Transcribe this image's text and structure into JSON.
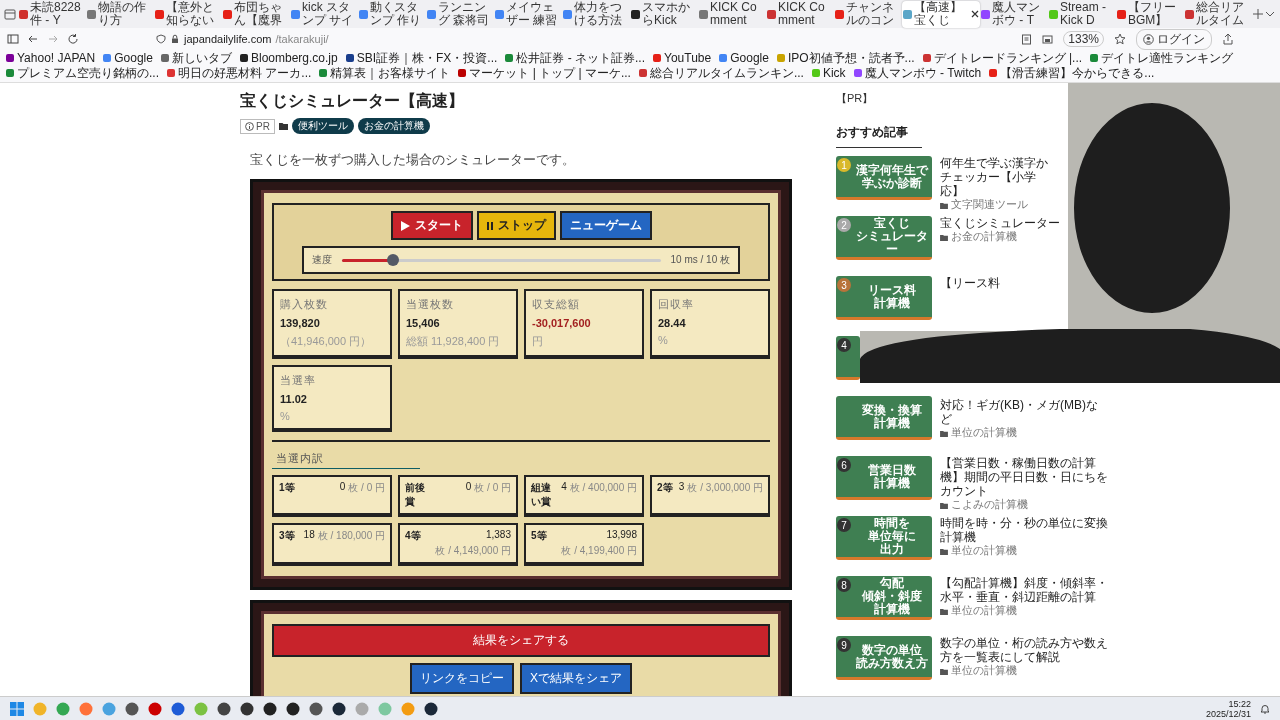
{
  "browser": {
    "tabs": [
      {
        "title": "未読8228件 - Y",
        "selected": false
      },
      {
        "title": "物語の作り方",
        "selected": false
      },
      {
        "title": "【意外と知らない",
        "selected": false
      },
      {
        "title": "布団ちゃん【魔界",
        "selected": false
      },
      {
        "title": "kick スタンプ サイ",
        "selected": false
      },
      {
        "title": "動くスタンプ 作り",
        "selected": false
      },
      {
        "title": "ランニング 森将司",
        "selected": false
      },
      {
        "title": "メイウェザー 練習",
        "selected": false
      },
      {
        "title": "体力をつける方法",
        "selected": false
      },
      {
        "title": "スマホからKick",
        "selected": false
      },
      {
        "title": "KICK Comment",
        "selected": false
      },
      {
        "title": "KICK Comment",
        "selected": false
      },
      {
        "title": "チャンネルのコン",
        "selected": false
      },
      {
        "title": "【高速】宝くじ",
        "selected": true
      },
      {
        "title": "魔人マンボウ - T",
        "selected": false
      },
      {
        "title": "Stream - Kick D",
        "selected": false
      },
      {
        "title": "【フリーBGM】",
        "selected": false
      },
      {
        "title": "総合リアルタイム",
        "selected": false
      }
    ],
    "address_host": "japandailylife.com",
    "address_path": "/takarakuji/",
    "zoom": "133%",
    "login": "ログイン",
    "bookmarks": [
      "Yahoo! JAPAN",
      "Google",
      "新しいタブ",
      "Bloomberg.co.jp",
      "SBI証券｜株・FX・投資...",
      "松井証券 - ネット証券...",
      "YouTube",
      "Google",
      "IPO初値予想・読者予...",
      "デイトレードランキング |...",
      "デイトレ適性ランキング",
      "プレミアム空売り銘柄の...",
      "明日の好悪材料 アーカ...",
      "精算表｜お客様サイト",
      "マーケット | トップ | マーケ...",
      "総合リアルタイムランキン...",
      "Kick",
      "魔人マンボウ - Twitch",
      "【滑舌練習】今からできる..."
    ]
  },
  "article": {
    "title": "宝くじシミュレーター【高速】",
    "pr": "PR",
    "tags": [
      "便利ツール",
      "お金の計算機"
    ],
    "description": "宝くじを一枚ずつ購入した場合のシミュレーターです。"
  },
  "simulator": {
    "buttons": [
      {
        "kind": "start",
        "label": "スタート"
      },
      {
        "kind": "stop",
        "label": "ストップ"
      },
      {
        "kind": "new",
        "label": "ニューゲーム"
      }
    ],
    "speed": {
      "label": "速度",
      "level": 0.16,
      "reading": "10 ms / 10 枚"
    },
    "stats": [
      {
        "label": "購入枚数",
        "value": "139,820",
        "sub": "（41,946,000 円）",
        "negative": false
      },
      {
        "label": "当選枚数",
        "value": "15,406",
        "sub": "総額 11,928,400 円",
        "negative": false
      },
      {
        "label": "収支総額",
        "value": "-30,017,600",
        "sub": "円",
        "negative": true
      },
      {
        "label": "回収率",
        "value": "28.44",
        "sub": "%",
        "negative": false
      },
      {
        "label": "当選率",
        "value": "11.02",
        "sub": "%",
        "negative": false
      }
    ],
    "breakdown_title": "当選内訳",
    "prizes": [
      {
        "name": "1等",
        "count": "0",
        "detail": "枚 / 0 円"
      },
      {
        "name": "前後賞",
        "count": "0",
        "detail": "枚 / 0 円"
      },
      {
        "name": "組違い賞",
        "count": "4",
        "detail": "枚 / 400,000 円"
      },
      {
        "name": "2等",
        "count": "3",
        "detail": "枚 / 3,000,000 円"
      },
      {
        "name": "3等",
        "count": "18",
        "detail": "枚 / 180,000 円"
      },
      {
        "name": "4等",
        "count": "1,383",
        "detail": "枚 / 4,149,000 円"
      },
      {
        "name": "5等",
        "count": "13,998",
        "detail": "枚 / 4,199,400 円"
      }
    ]
  },
  "share": {
    "title": "結果をシェアする",
    "buttons": [
      "リンクをコピー",
      "Xで結果をシェア"
    ]
  },
  "sidebar": {
    "pr": "【PR】",
    "heading": "おすすめ記事",
    "articles": [
      {
        "kind": "full",
        "rank": "1",
        "color": "#d9b92a",
        "thumb_lines": [
          "漢字何年生で",
          "学ぶか診断"
        ],
        "title_lines": [
          "何年生で学ぶ漢字か",
          "チェッカー【小学",
          "応】"
        ],
        "category": "文字関連ツール"
      },
      {
        "kind": "full",
        "rank": "2",
        "color": "#a9a9a9",
        "thumb_lines": [
          "宝くじ",
          "シミュレーター"
        ],
        "title_lines": [
          "宝くじシミュレーター"
        ],
        "category": "お金の計算機"
      },
      {
        "kind": "full",
        "rank": "3",
        "color": "#b8733a",
        "thumb_lines": [
          "リース料",
          "計算機"
        ],
        "title_lines": [
          "【リース料"
        ]
      },
      {
        "kind": "covered",
        "rank": "4",
        "color": "#333333"
      },
      {
        "kind": "cut",
        "thumb_lines": [
          "変換・換算",
          "計算機"
        ],
        "title_lines": [
          "対応！ギガ(KB)・メガ(MB)な",
          "ど"
        ],
        "category": "単位の計算機"
      },
      {
        "kind": "full",
        "rank": "6",
        "color": "#333333",
        "thumb_lines": [
          "営業日数",
          "計算機"
        ],
        "title_lines": [
          "【営業日数・稼働日数の計算",
          "機】期間の平日日数・日にちを",
          "カウント"
        ],
        "category": "こよみの計算機"
      },
      {
        "kind": "full",
        "rank": "7",
        "color": "#333333",
        "thumb_lines": [
          "時間を",
          "単位毎に",
          "出力"
        ],
        "title_lines": [
          "時間を時・分・秒の単位に変換",
          "計算機"
        ],
        "category": "単位の計算機"
      },
      {
        "kind": "full",
        "rank": "8",
        "color": "#333333",
        "thumb_lines": [
          "勾配",
          "傾斜・斜度",
          "計算機"
        ],
        "title_lines": [
          "【勾配計算機】斜度・傾斜率・",
          "水平・垂直・斜辺距離の計算"
        ],
        "category": "単位の計算機"
      },
      {
        "kind": "full",
        "rank": "9",
        "color": "#333333",
        "thumb_lines": [
          "数字の単位",
          "読み方数え方"
        ],
        "title_lines": [
          "数字の単位・桁の読み方や数え",
          "方を一覧表にして解説"
        ],
        "category": "単位の計算機"
      }
    ]
  },
  "taskbar": {
    "time": "15:22",
    "date": "2025/12/31"
  }
}
